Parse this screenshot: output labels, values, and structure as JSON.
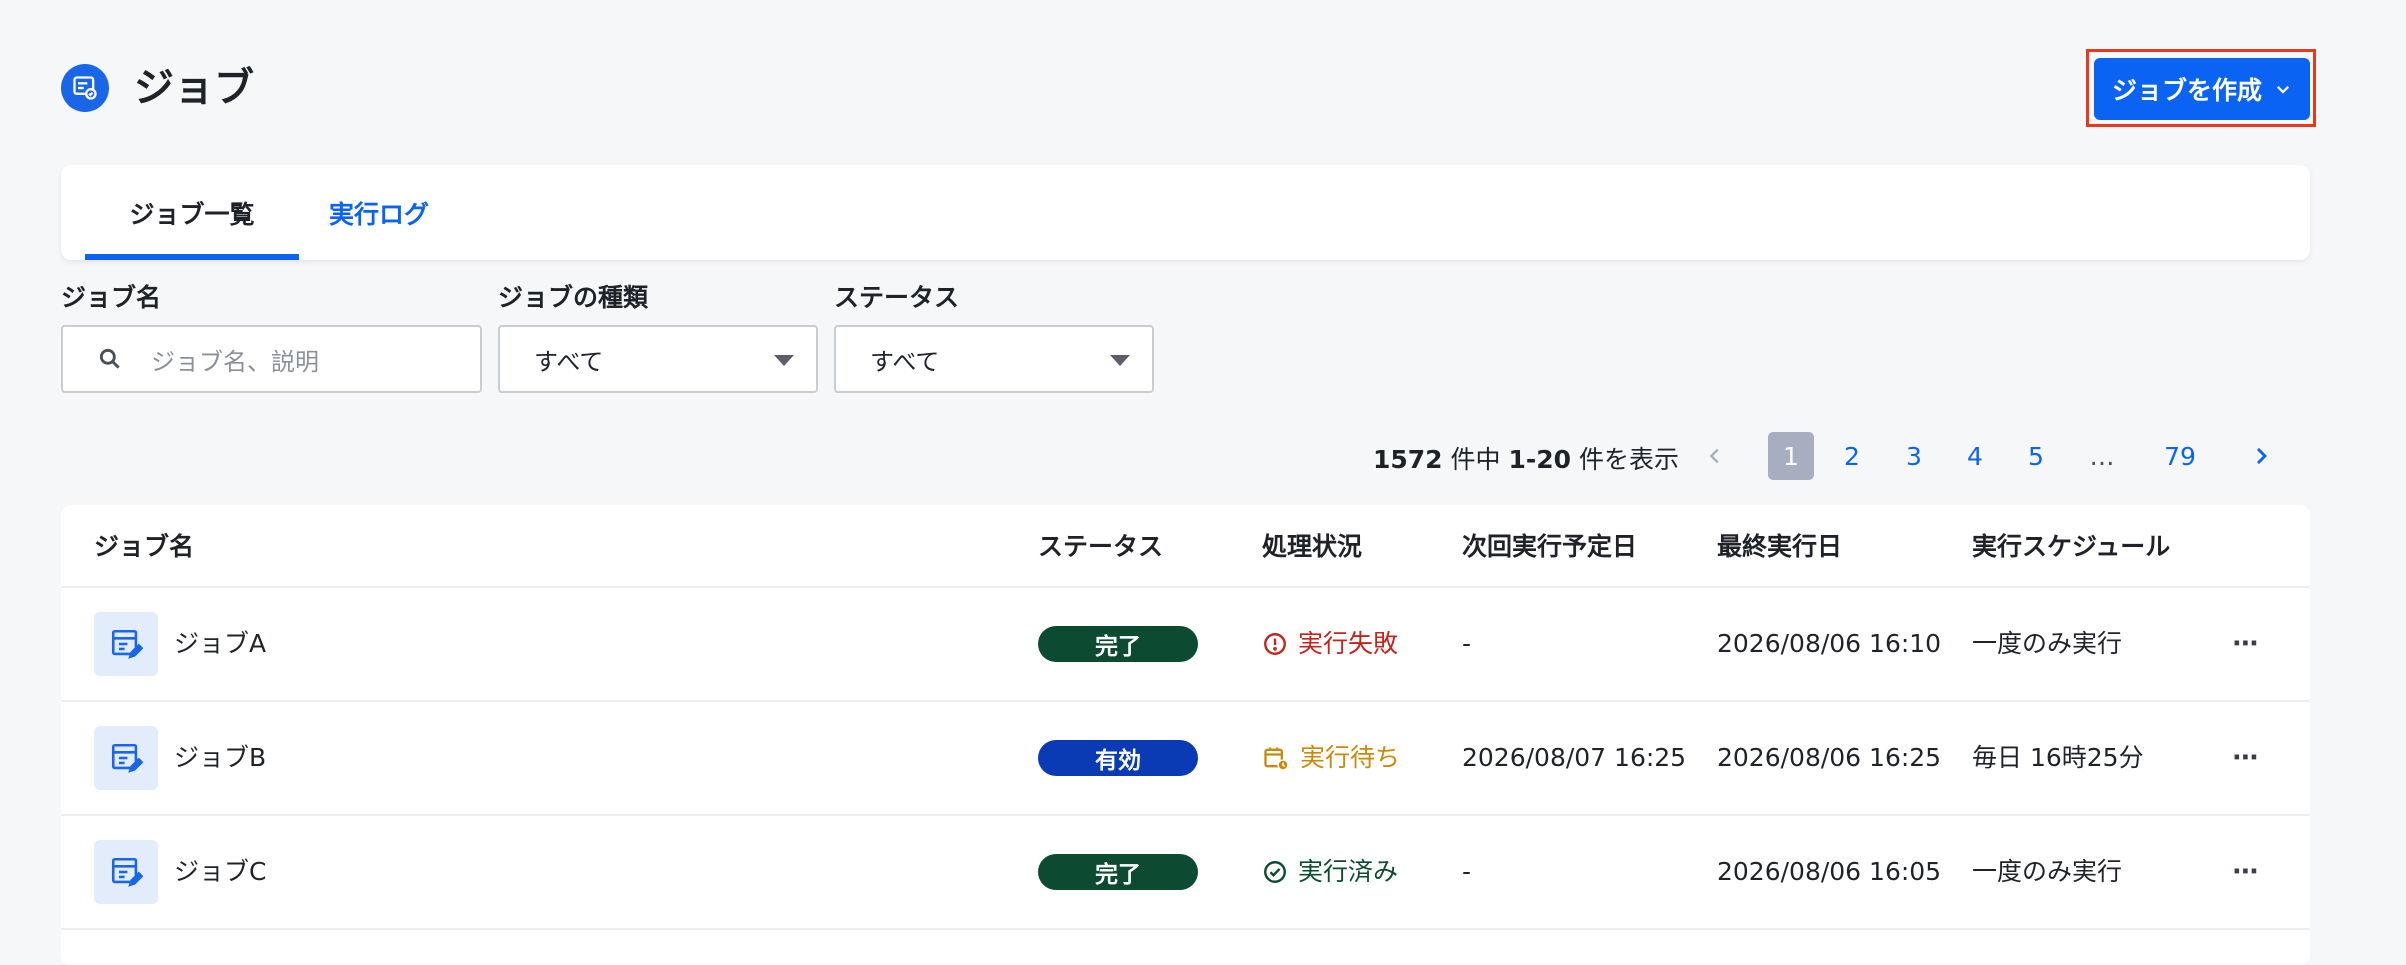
{
  "header": {
    "title": "ジョブ",
    "create_button": "ジョブを作成"
  },
  "tabs": [
    {
      "label": "ジョブ一覧",
      "active": true
    },
    {
      "label": "実行ログ",
      "active": false
    }
  ],
  "filters": {
    "job_name": {
      "label": "ジョブ名",
      "placeholder": "ジョブ名、説明"
    },
    "job_type": {
      "label": "ジョブの種類",
      "value": "すべて"
    },
    "status": {
      "label": "ステータス",
      "value": "すべて"
    }
  },
  "pagination": {
    "total": "1572",
    "mid": "件中",
    "range": "1-20",
    "suffix": "件を表示",
    "pages": [
      "1",
      "2",
      "3",
      "4",
      "5",
      "…",
      "79"
    ],
    "current": "1"
  },
  "table": {
    "columns": [
      "ジョブ名",
      "ステータス",
      "処理状況",
      "次回実行予定日",
      "最終実行日",
      "実行スケジュール"
    ],
    "rows": [
      {
        "name": "ジョブA",
        "status": "完了",
        "status_color": "#0c4a32",
        "proc": "実行失敗",
        "proc_color": "#c4241f",
        "proc_icon": "alert-circle-icon",
        "next": "-",
        "last": "2026/08/06 16:10",
        "schedule": "一度のみ実行"
      },
      {
        "name": "ジョブB",
        "status": "有効",
        "status_color": "#0a3bb5",
        "proc": "実行待ち",
        "proc_color": "#c68b0c",
        "proc_icon": "calendar-clock-icon",
        "next": "2026/08/07 16:25",
        "last": "2026/08/06 16:25",
        "schedule": "毎日 16時25分"
      },
      {
        "name": "ジョブC",
        "status": "完了",
        "status_color": "#0c4a32",
        "proc": "実行済み",
        "proc_color": "#0c4a32",
        "proc_icon": "check-circle-icon",
        "next": "-",
        "last": "2026/08/06 16:05",
        "schedule": "一度のみ実行"
      }
    ]
  },
  "colors": {
    "accent": "#0b63f3",
    "highlight_border": "#e8391d",
    "background": "#f6f7f9"
  }
}
